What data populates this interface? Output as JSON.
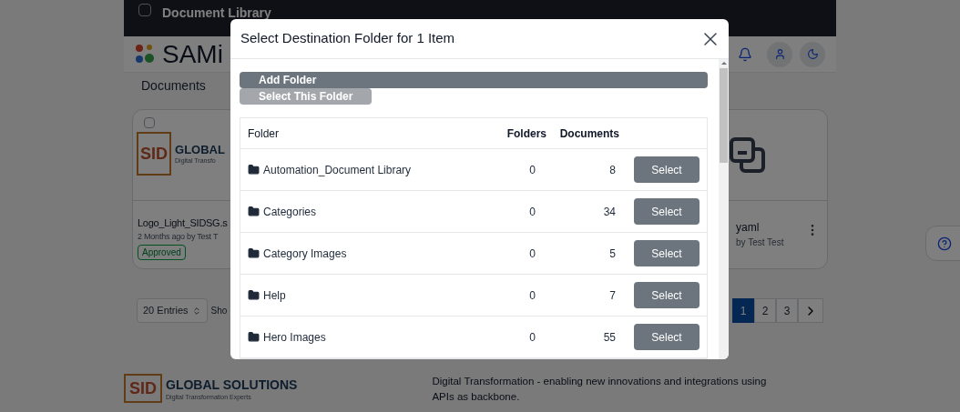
{
  "header": {
    "title": "Document Library"
  },
  "brand": {
    "name": "SAMi"
  },
  "breadcrumb": "Documents",
  "cards": [
    {
      "kind": "image",
      "checked": false,
      "logo": {
        "mark": "SID",
        "name": "GLOBAL",
        "slogan": "Digital Transfo"
      },
      "name": "Logo_Light_SIDSG.s",
      "meta": "2 Months ago by Test T",
      "badge": "Approved"
    },
    {
      "kind": "file",
      "name": "yaml",
      "meta": "by Test Test"
    }
  ],
  "entries": {
    "value": "20 Entries"
  },
  "show_label": "Sho",
  "pagination": {
    "pages": [
      {
        "label": "1",
        "selected": true
      },
      {
        "label": "2",
        "selected": false
      },
      {
        "label": "3",
        "selected": false
      }
    ]
  },
  "footer": {
    "logo": {
      "mark": "SID",
      "name": "GLOBAL SOLUTIONS",
      "slogan": "Digital Transformation Experts"
    },
    "tagline": "Digital Transformation - enabling new innovations and integrations using APIs as backbone."
  },
  "modal": {
    "title": "Select Destination Folder for 1 Item",
    "buttons": [
      {
        "label": "Add Folder",
        "disabled": false
      },
      {
        "label": "Select This Folder",
        "disabled": true
      }
    ],
    "table": {
      "columns": [
        "Folder",
        "Folders",
        "Documents"
      ],
      "rows": [
        {
          "folder": "Automation_Document Library",
          "folders": "0",
          "documents": "8",
          "action": "Select"
        },
        {
          "folder": "Categories",
          "folders": "0",
          "documents": "34",
          "action": "Select"
        },
        {
          "folder": "Category Images",
          "folders": "0",
          "documents": "5",
          "action": "Select"
        },
        {
          "folder": "Help",
          "folders": "0",
          "documents": "7",
          "action": "Select"
        },
        {
          "folder": "Hero Images",
          "folders": "0",
          "documents": "55",
          "action": "Select"
        }
      ]
    }
  }
}
